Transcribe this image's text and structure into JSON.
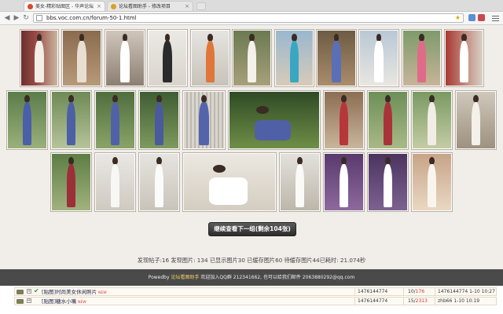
{
  "browser": {
    "tabs": [
      {
        "title": "美女-精彩贴图区 - 华声论坛",
        "active": true,
        "favicon_color": "#d84a2a"
      },
      {
        "title": "论坛看图助手 - 修改项目",
        "active": false,
        "favicon_color": "#d8a22a"
      }
    ],
    "url": "bbs.voc.com.cn/forum-50-1.html"
  },
  "gallery": {
    "load_more_label": "继续查看下一组(剩余104张)",
    "stats_text": "发现帖子:16 发现图片: 134 已显示图片30 已缓存图片60 待缓存图片44已耗时:  21.074秒"
  },
  "powered": {
    "prefix": "Powedby",
    "link": "论坛看图助手",
    "rest": "欢迎加入QQ群 212341662, 也可以给我们邮件 2063880292@qq.com"
  },
  "forum_rows": [
    {
      "title": "[贴图]时尚美女休闲照片",
      "badge": "NEW",
      "id": "1476144774",
      "replies": "10",
      "views": "176",
      "last": "1476144774 1-10 10:27"
    },
    {
      "title": "[贴图]糖水小嘴",
      "badge": "NEW",
      "id": "1476144774",
      "replies": "15",
      "views": "2313",
      "last": "zhb66 1-10 10:19"
    }
  ],
  "colors": {
    "page_bg": "#f1eeea",
    "powered_bg": "#4a4a4a",
    "button_bg": "#3a3a3a"
  }
}
